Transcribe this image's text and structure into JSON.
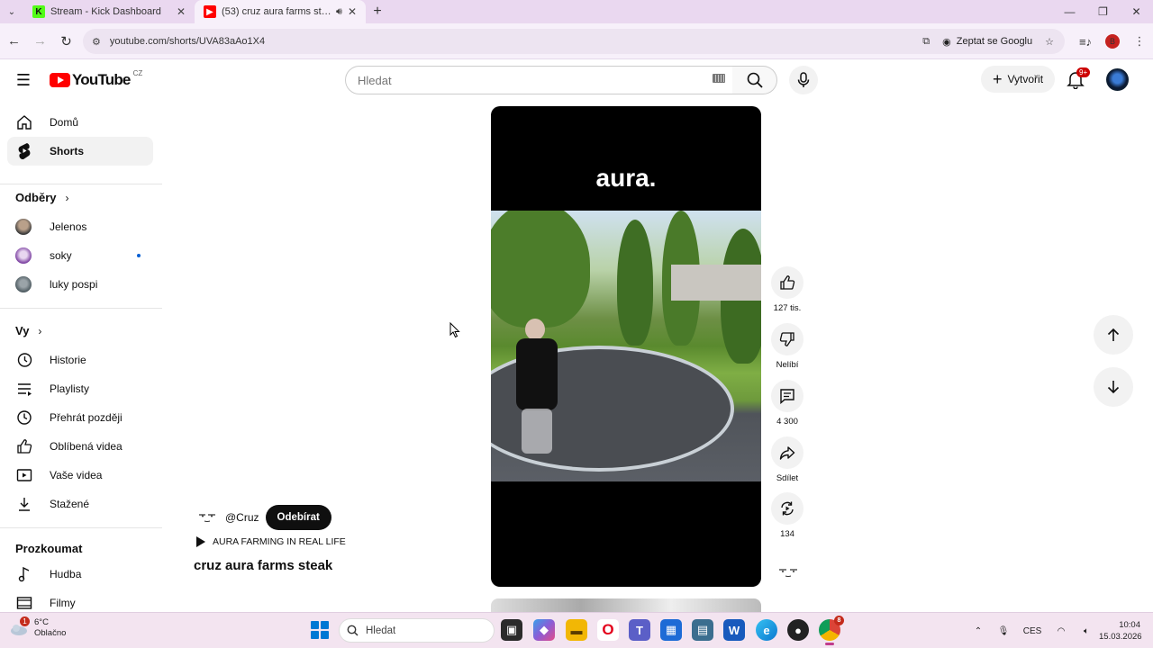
{
  "browser": {
    "tabs": [
      {
        "title": "Stream - Kick Dashboard",
        "active": false,
        "favicon": "kick-favicon"
      },
      {
        "title": "(53) cruz aura farms steak -",
        "active": true,
        "favicon": "youtube-favicon",
        "audio": true
      }
    ],
    "url": "youtube.com/shorts/UVA83aAo1X4",
    "ask_google": "Zeptat se Googlu",
    "profile_initial": "B"
  },
  "header": {
    "logo_text": "YouTube",
    "country_code": "CZ",
    "search_placeholder": "Hledat",
    "create_label": "Vytvořit",
    "notification_badge": "9+"
  },
  "sidebar": {
    "main": [
      {
        "label": "Domů",
        "icon": "home-icon"
      },
      {
        "label": "Shorts",
        "icon": "shorts-icon",
        "active": true
      }
    ],
    "subscriptions_heading": "Odběry",
    "subscriptions": [
      {
        "label": "Jelenos"
      },
      {
        "label": "soky",
        "live": true
      },
      {
        "label": "luky pospi"
      }
    ],
    "you_heading": "Vy",
    "you": [
      {
        "label": "Historie",
        "icon": "history-icon"
      },
      {
        "label": "Playlisty",
        "icon": "playlist-icon"
      },
      {
        "label": "Přehrát později",
        "icon": "watch-later-icon"
      },
      {
        "label": "Oblíbená videa",
        "icon": "liked-icon"
      },
      {
        "label": "Vaše videa",
        "icon": "your-videos-icon"
      },
      {
        "label": "Stažené",
        "icon": "download-icon"
      }
    ],
    "explore_heading": "Prozkoumat",
    "explore": [
      {
        "label": "Hudba",
        "icon": "music-icon"
      },
      {
        "label": "Filmy",
        "icon": "movies-icon"
      }
    ]
  },
  "short": {
    "caption": "aura.",
    "channel": "@Cruz",
    "subscribe_label": "Odebírat",
    "tag": "AURA FARMING IN REAL LIFE",
    "title": "cruz aura farms steak",
    "likes": "127 tis.",
    "dislike_label": "Nelíbí",
    "comments": "4 300",
    "share_label": "Sdílet",
    "remix": "134"
  },
  "taskbar": {
    "temperature": "6°C",
    "weather": "Oblačno",
    "weather_badge": "1",
    "search_placeholder": "Hledat",
    "language": "CES",
    "time": "10:04",
    "date": "15.03.2026",
    "chrome_badge": "8"
  }
}
